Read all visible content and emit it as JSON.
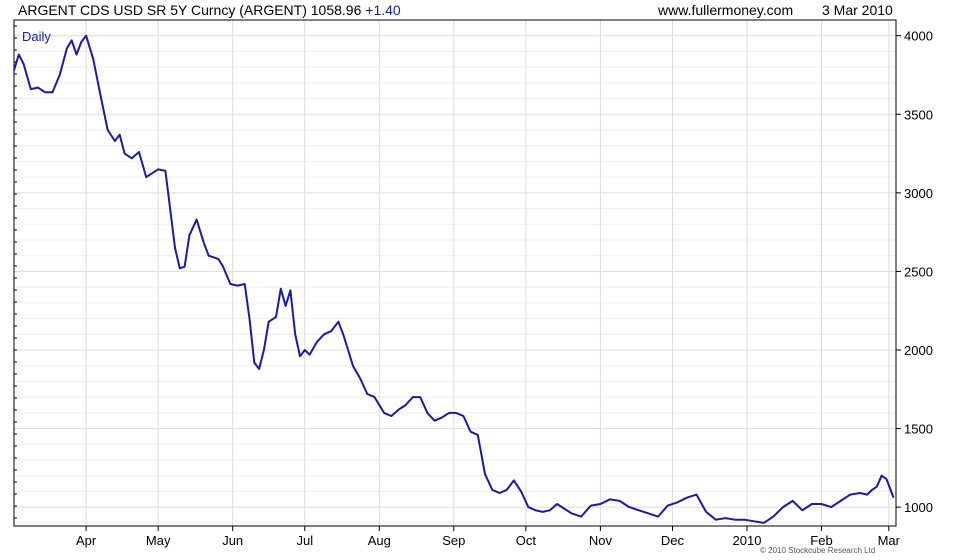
{
  "header": {
    "title": "ARGENT CDS USD SR 5Y Curncy (ARGENT) 1058.96",
    "change": "+1.40",
    "site": "www.fullermoney.com",
    "date": "3 Mar 2010"
  },
  "copyright": "© 2010 Stockcube Research Ltd",
  "colors": {
    "line": "#1a1aa6",
    "frame": "#000000",
    "grid": "#dcdcdc"
  },
  "chart_data": {
    "type": "line",
    "title": "ARGENT CDS USD SR 5Y Curncy (ARGENT) 1058.96 +1.40",
    "frequency_label": "Daily",
    "x_tick_labels": [
      "Apr",
      "May",
      "Jun",
      "Jul",
      "Aug",
      "Sep",
      "Oct",
      "Nov",
      "Dec",
      "2010",
      "Feb",
      "Mar"
    ],
    "y_tick_labels": [
      "1000",
      "1500",
      "2000",
      "2500",
      "3000",
      "3500",
      "4000"
    ],
    "y_ticks": [
      1000,
      1500,
      2000,
      2500,
      3000,
      3500,
      4000
    ],
    "ylim": [
      880,
      4100
    ],
    "x_range": [
      "2009-03-02",
      "2010-03-04"
    ],
    "grid": true,
    "y_axis_position": "right",
    "series": [
      {
        "x": [
          "2009-03-02",
          "2009-03-04",
          "2009-03-06",
          "2009-03-09",
          "2009-03-12",
          "2009-03-15",
          "2009-03-18",
          "2009-03-21",
          "2009-03-24",
          "2009-03-26",
          "2009-03-28",
          "2009-03-30",
          "2009-04-01",
          "2009-04-04",
          "2009-04-07",
          "2009-04-10",
          "2009-04-13",
          "2009-04-15",
          "2009-04-17",
          "2009-04-20",
          "2009-04-23",
          "2009-04-26",
          "2009-04-29",
          "2009-05-01",
          "2009-05-04",
          "2009-05-08",
          "2009-05-10",
          "2009-05-12",
          "2009-05-14",
          "2009-05-17",
          "2009-05-20",
          "2009-05-22",
          "2009-05-24",
          "2009-05-26",
          "2009-05-28",
          "2009-05-31",
          "2009-06-03",
          "2009-06-06",
          "2009-06-08",
          "2009-06-10",
          "2009-06-12",
          "2009-06-14",
          "2009-06-16",
          "2009-06-19",
          "2009-06-21",
          "2009-06-23",
          "2009-06-25",
          "2009-06-27",
          "2009-06-29",
          "2009-07-01",
          "2009-07-03",
          "2009-07-06",
          "2009-07-09",
          "2009-07-12",
          "2009-07-15",
          "2009-07-17",
          "2009-07-19",
          "2009-07-21",
          "2009-07-24",
          "2009-07-27",
          "2009-07-30",
          "2009-08-03",
          "2009-08-06",
          "2009-08-09",
          "2009-08-12",
          "2009-08-15",
          "2009-08-18",
          "2009-08-21",
          "2009-08-24",
          "2009-08-27",
          "2009-08-30",
          "2009-09-02",
          "2009-09-05",
          "2009-09-08",
          "2009-09-11",
          "2009-09-14",
          "2009-09-17",
          "2009-09-20",
          "2009-09-23",
          "2009-09-26",
          "2009-09-29",
          "2009-10-02",
          "2009-10-05",
          "2009-10-08",
          "2009-10-11",
          "2009-10-14",
          "2009-10-17",
          "2009-10-20",
          "2009-10-24",
          "2009-10-28",
          "2009-11-01",
          "2009-11-05",
          "2009-11-09",
          "2009-11-13",
          "2009-11-17",
          "2009-11-21",
          "2009-11-25",
          "2009-11-29",
          "2009-12-03",
          "2009-12-07",
          "2009-12-11",
          "2009-12-15",
          "2009-12-19",
          "2009-12-23",
          "2009-12-27",
          "2009-12-31",
          "2010-01-04",
          "2010-01-08",
          "2010-01-12",
          "2010-01-16",
          "2010-01-20",
          "2010-01-24",
          "2010-01-28",
          "2010-02-01",
          "2010-02-05",
          "2010-02-09",
          "2010-02-13",
          "2010-02-17",
          "2010-02-20",
          "2010-02-22",
          "2010-02-24",
          "2010-02-26",
          "2010-02-28",
          "2010-03-03"
        ],
        "y": [
          3780,
          3880,
          3820,
          3660,
          3670,
          3640,
          3640,
          3750,
          3920,
          3970,
          3880,
          3960,
          4000,
          3850,
          3620,
          3400,
          3330,
          3370,
          3250,
          3220,
          3260,
          3100,
          3130,
          3150,
          3140,
          2650,
          2520,
          2530,
          2730,
          2830,
          2680,
          2600,
          2590,
          2580,
          2530,
          2420,
          2410,
          2420,
          2200,
          1920,
          1880,
          2000,
          2180,
          2210,
          2390,
          2280,
          2380,
          2100,
          1960,
          2000,
          1970,
          2050,
          2100,
          2120,
          2180,
          2100,
          2000,
          1900,
          1820,
          1720,
          1700,
          1600,
          1580,
          1620,
          1650,
          1700,
          1700,
          1600,
          1550,
          1570,
          1600,
          1600,
          1580,
          1480,
          1460,
          1210,
          1110,
          1090,
          1110,
          1170,
          1100,
          1000,
          980,
          970,
          980,
          1020,
          990,
          960,
          940,
          1010,
          1020,
          1050,
          1040,
          1000,
          980,
          960,
          940,
          1010,
          1030,
          1060,
          1080,
          970,
          920,
          930,
          920,
          920,
          910,
          900,
          940,
          1000,
          1040,
          980,
          1020,
          1020,
          1000,
          1040,
          1080,
          1090,
          1080,
          1110,
          1130,
          1200,
          1180,
          1060
        ]
      }
    ]
  }
}
